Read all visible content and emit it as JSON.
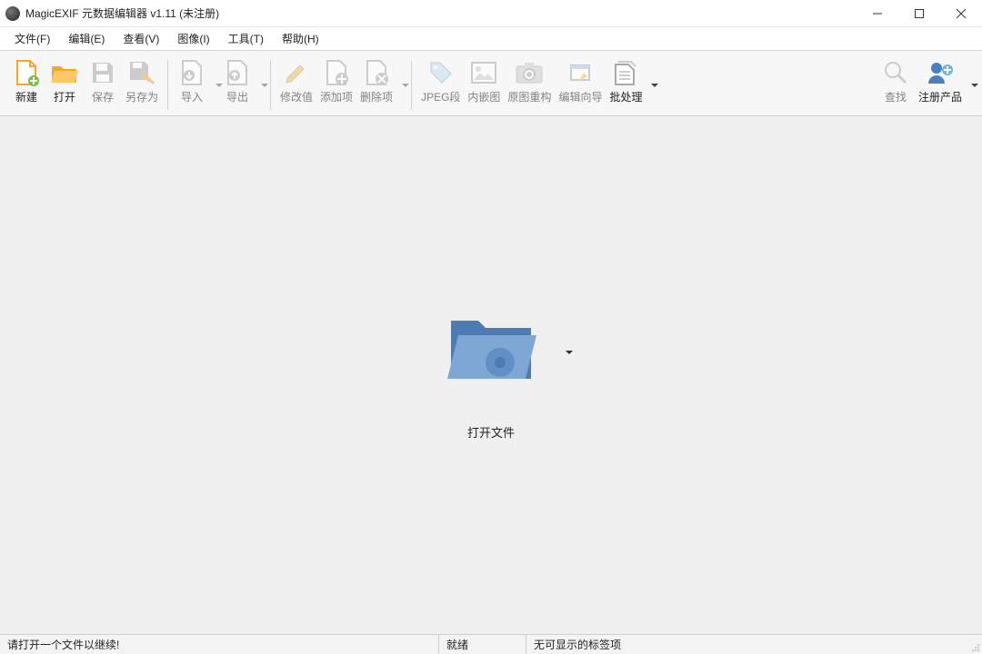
{
  "window": {
    "title": "MagicEXIF 元数据编辑器 v1.11 (未注册)"
  },
  "menubar": {
    "file": "文件(F)",
    "edit": "编辑(E)",
    "view": "查看(V)",
    "image": "图像(I)",
    "tools": "工具(T)",
    "help": "帮助(H)"
  },
  "toolbar": {
    "new": "新建",
    "open": "打开",
    "save": "保存",
    "saveas": "另存为",
    "import": "导入",
    "export": "导出",
    "modify": "修改值",
    "add": "添加项",
    "delete": "删除项",
    "jpegseg": "JPEG段",
    "embed": "内嵌图",
    "rebuild": "原图重构",
    "wizard": "编辑向导",
    "batch": "批处理",
    "find": "查找",
    "register": "注册产品"
  },
  "main": {
    "open_file_label": "打开文件"
  },
  "statusbar": {
    "hint": "请打开一个文件以继续!",
    "ready": "就绪",
    "notabs": "无可显示的标签项"
  },
  "colors": {
    "orange": "#f6a623",
    "blue": "#5b8fc7",
    "gray": "#a9a9a9"
  }
}
